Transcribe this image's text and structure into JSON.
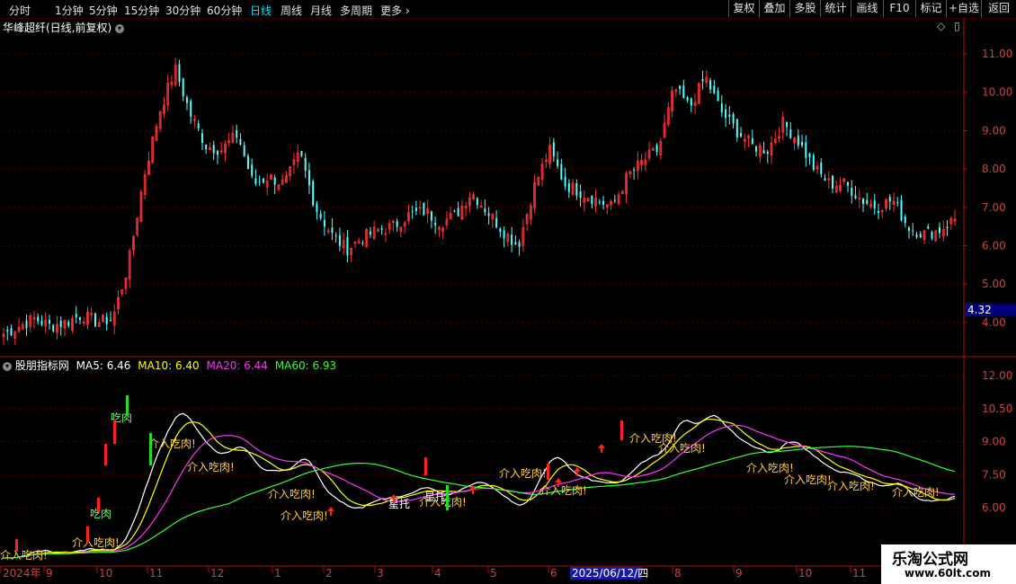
{
  "toolbar": {
    "periods": [
      "分时",
      "1分钟",
      "5分钟",
      "15分钟",
      "30分钟",
      "60分钟",
      "日线",
      "周线",
      "月线",
      "多周期",
      "更多"
    ],
    "active_period": "日线",
    "buttons": [
      "复权",
      "叠加",
      "多股",
      "统计",
      "画线",
      "F10",
      "标记",
      "+自选",
      "返回"
    ]
  },
  "main_panel": {
    "title": "华峰超纤(日线,前复权)",
    "price_labels": [
      "11.00",
      "10.00",
      "9.00",
      "8.00",
      "7.00",
      "6.00",
      "5.00",
      "4.00"
    ],
    "current_price": "4.32"
  },
  "indicator_panel": {
    "name": "股朋指标网",
    "ma": [
      {
        "label": "MA5: 6.46",
        "color": "#ffffff"
      },
      {
        "label": "MA10: 6.40",
        "color": "#ffff00"
      },
      {
        "label": "MA20: 6.44",
        "color": "#ff33ff"
      },
      {
        "label": "MA60: 6.93",
        "color": "#33ff33"
      }
    ],
    "price_labels": [
      "12.00",
      "10.50",
      "9.00",
      "7.50",
      "6.00"
    ],
    "signal_text": "介入吃肉!",
    "other_labels": [
      "吃肉",
      "星托"
    ]
  },
  "time_axis": {
    "labels": [
      "2024年",
      "9",
      "10",
      "11",
      "12",
      "1",
      "2",
      "3",
      "4",
      "5",
      "6",
      "7",
      "8",
      "9",
      "10",
      "11"
    ],
    "cursor_date": "2025/06/12/四"
  },
  "watermark": {
    "line1": "乐淘公式网",
    "line2": "www.60lt.com"
  },
  "colors": {
    "up": "#ff3333",
    "down": "#54ffff",
    "grid": "#5a0000",
    "axis_text": "#d24040"
  },
  "chart_data": {
    "type": "candlestick",
    "title": "华峰超纤(日线,前复权)",
    "y_range": [
      3.2,
      11.7
    ],
    "x_start": "2024-08",
    "x_end": "2025-11",
    "approx_close_path": [
      3.7,
      3.9,
      4.1,
      3.9,
      4.0,
      4.2,
      4.0,
      4.1,
      5.5,
      7.8,
      9.5,
      10.6,
      9.4,
      8.6,
      8.5,
      8.9,
      7.6,
      7.8,
      7.6,
      8.4,
      7.0,
      6.3,
      5.9,
      6.2,
      6.4,
      6.5,
      6.8,
      6.9,
      6.6,
      6.8,
      7.4,
      6.9,
      6.4,
      6.0,
      7.5,
      8.5,
      7.6,
      7.4,
      7.2,
      7.0,
      7.8,
      8.2,
      8.5,
      10.1,
      9.6,
      10.4,
      9.5,
      9.0,
      8.6,
      8.5,
      9.2,
      8.7,
      8.0,
      7.6,
      7.6,
      7.2,
      7.0,
      7.2,
      6.5,
      6.3,
      6.4,
      6.7
    ]
  }
}
